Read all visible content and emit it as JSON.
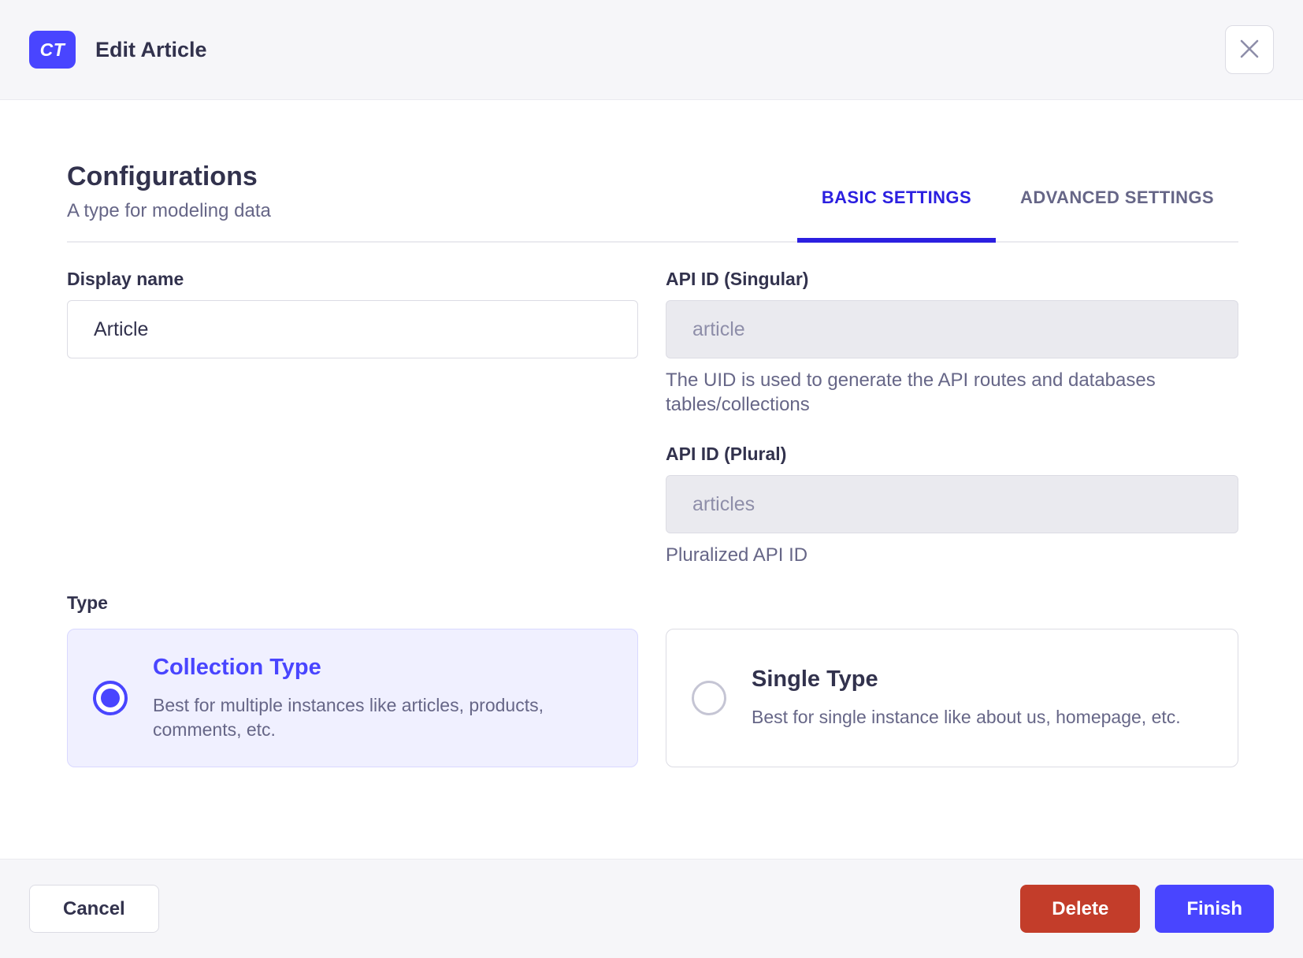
{
  "header": {
    "badge": "CT",
    "title": "Edit Article"
  },
  "section": {
    "title": "Configurations",
    "subtitle": "A type for modeling data",
    "tabs": [
      {
        "label": "BASIC SETTINGS",
        "active": true
      },
      {
        "label": "ADVANCED SETTINGS",
        "active": false
      }
    ]
  },
  "form": {
    "display_name": {
      "label": "Display name",
      "value": "Article"
    },
    "api_id_singular": {
      "label": "API ID (Singular)",
      "value": "article",
      "hint": "The UID is used to generate the API routes and databases tables/collections"
    },
    "api_id_plural": {
      "label": "API ID (Plural)",
      "value": "articles",
      "hint": "Pluralized API ID"
    },
    "type": {
      "label": "Type",
      "options": [
        {
          "title": "Collection Type",
          "description": "Best for multiple instances like articles, products, comments, etc.",
          "selected": true
        },
        {
          "title": "Single Type",
          "description": "Best for single instance like about us, homepage, etc.",
          "selected": false
        }
      ]
    }
  },
  "footer": {
    "cancel_label": "Cancel",
    "delete_label": "Delete",
    "finish_label": "Finish"
  },
  "colors": {
    "accent": "#4945ff",
    "tab-active": "#2b1fe0",
    "danger": "#c33d2a",
    "surface": "#f6f6f9",
    "selected-bg": "#f0f0ff"
  }
}
